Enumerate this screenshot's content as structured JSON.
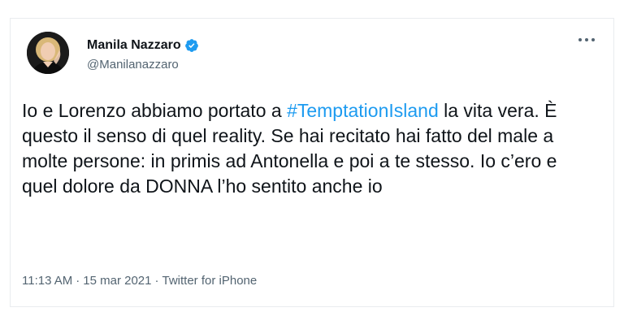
{
  "author": {
    "display_name": "Manila Nazzaro",
    "handle": "@Manilanazzaro",
    "verified_icon": "verified-badge-icon",
    "avatar_icon": "avatar-photo"
  },
  "menu": {
    "more_icon": "more-options-icon"
  },
  "tweet": {
    "text_part1": "Io e Lorenzo abbiamo portato a ",
    "hashtag": "#TemptationIsland",
    "text_part2": " la vita vera. È questo il senso di quel reality. Se hai recitato hai fatto del male a molte persone: in primis ad Antonella e poi a te stesso. Io c’ero e quel dolore da DONNA l’ho sentito anche io"
  },
  "meta": {
    "time": "11:13 AM",
    "separator1": "·",
    "date": "15 mar 2021",
    "separator2": "·",
    "source": "Twitter for iPhone"
  },
  "colors": {
    "link": "#1d9bf0",
    "text": "#0f1419",
    "secondary": "#536471"
  }
}
